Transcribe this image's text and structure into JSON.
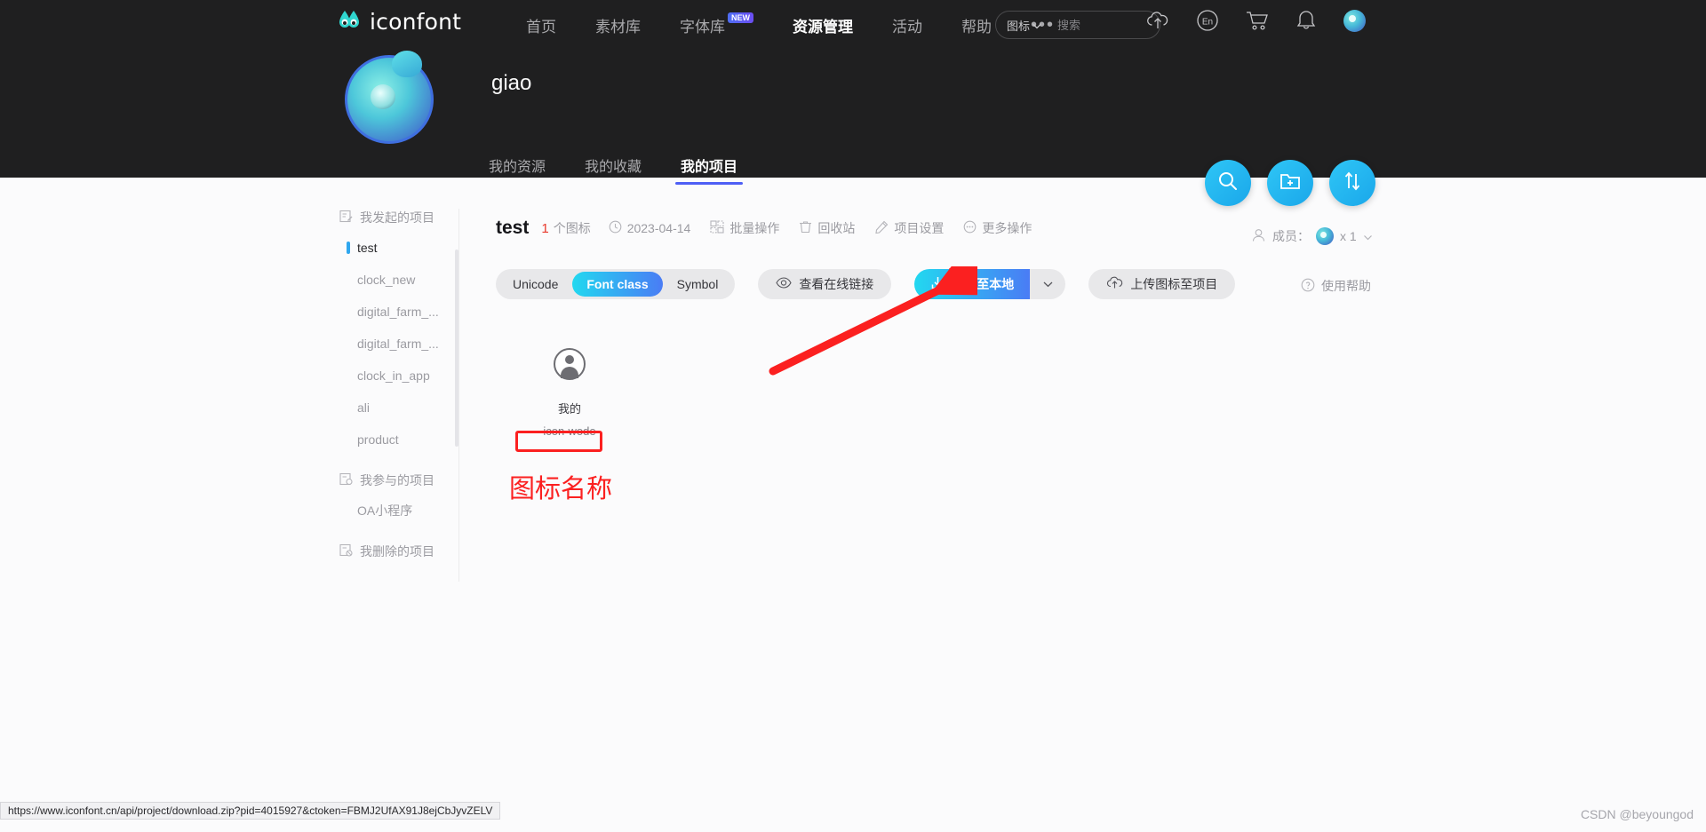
{
  "site": {
    "logo_text": "iconfont",
    "logo_icon": "iconfont-droplet-logo"
  },
  "topnav": {
    "items": [
      {
        "label": "首页",
        "active": false,
        "badge": null
      },
      {
        "label": "素材库",
        "active": false,
        "badge": null
      },
      {
        "label": "字体库",
        "active": false,
        "badge": "NEW"
      },
      {
        "label": "资源管理",
        "active": true,
        "badge": null
      },
      {
        "label": "活动",
        "active": false,
        "badge": null
      },
      {
        "label": "帮助",
        "active": false,
        "badge": null
      }
    ],
    "more_label": "•••",
    "search": {
      "category": "图标",
      "placeholder": "搜索",
      "value": "",
      "search_icon": "search-icon",
      "caret_icon": "chevron-down-icon"
    },
    "icons": [
      {
        "name": "upload-cloud-icon"
      },
      {
        "name": "language-en-icon",
        "label": "En"
      },
      {
        "name": "shopping-cart-icon"
      },
      {
        "name": "notification-bell-icon"
      },
      {
        "name": "user-avatar-icon"
      }
    ]
  },
  "profile": {
    "name": "giao",
    "avatar_icon": "user-profile-avatar",
    "tabs": [
      {
        "label": "我的资源",
        "active": false
      },
      {
        "label": "我的收藏",
        "active": false
      },
      {
        "label": "我的项目",
        "active": true
      }
    ]
  },
  "fabs": [
    {
      "name": "search-fab",
      "icon": "search-icon"
    },
    {
      "name": "new-folder-fab",
      "icon": "folder-plus-icon"
    },
    {
      "name": "sort-fab",
      "icon": "sort-updown-icon"
    }
  ],
  "sidebar": {
    "groups": [
      {
        "title": "我发起的项目",
        "icon": "project-created-icon",
        "items": [
          {
            "label": "test",
            "active": true
          },
          {
            "label": "clock_new",
            "active": false
          },
          {
            "label": "digital_farm_...",
            "active": false
          },
          {
            "label": "digital_farm_...",
            "active": false
          },
          {
            "label": "clock_in_app",
            "active": false
          },
          {
            "label": "ali",
            "active": false
          },
          {
            "label": "product",
            "active": false
          }
        ]
      },
      {
        "title": "我参与的项目",
        "icon": "project-joined-icon",
        "items": [
          {
            "label": "OA小程序",
            "active": false
          }
        ]
      },
      {
        "title": "我删除的项目",
        "icon": "project-deleted-icon",
        "items": []
      }
    ]
  },
  "project": {
    "name": "test",
    "icon_count": "1",
    "icon_count_unit": "个图标",
    "date": "2023-04-14",
    "date_icon": "clock-icon",
    "actions": [
      {
        "label": "批量操作",
        "icon": "batch-operate-icon"
      },
      {
        "label": "回收站",
        "icon": "recycle-bin-icon"
      },
      {
        "label": "项目设置",
        "icon": "pencil-settings-icon"
      },
      {
        "label": "更多操作",
        "icon": "more-ellipsis-icon"
      }
    ],
    "members": {
      "label": "成员：",
      "icon": "members-icon",
      "count": "x 1",
      "caret_icon": "chevron-down-icon"
    }
  },
  "toolbar": {
    "segments": [
      {
        "label": "Unicode",
        "active": false
      },
      {
        "label": "Font class",
        "active": true
      },
      {
        "label": "Symbol",
        "active": false
      }
    ],
    "view_online_link": {
      "label": "查看在线链接",
      "icon": "eye-icon"
    },
    "download_local": {
      "label": "下载至本地",
      "icon": "download-icon",
      "caret_icon": "chevron-down-icon"
    },
    "upload_icons": {
      "label": "上传图标至项目",
      "icon": "upload-cloud-icon"
    },
    "usage_help": {
      "label": "使用帮助",
      "icon": "question-circle-icon"
    }
  },
  "icons_grid": [
    {
      "glyph_name": "person-avatar-icon",
      "label": "我的",
      "classname": "icon-wode"
    }
  ],
  "annotations": {
    "label": "图标名称",
    "highlight_color": "#fb2020",
    "arrow": "red-arrow-pointing-to-download-button"
  },
  "status_bar": {
    "url": "https://www.iconfont.cn/api/project/download.zip?pid=4015927&ctoken=FBMJ2UfAX91J8ejCbJyvZELV"
  },
  "watermark": "CSDN @beyoungod",
  "colors": {
    "dark_bg": "#1f1f20",
    "page_bg": "#fbfbfc",
    "accent_blue": "#4e5ff5",
    "cyan": "#22d8f0",
    "red": "#fb2020",
    "count_red": "#e8392c"
  }
}
